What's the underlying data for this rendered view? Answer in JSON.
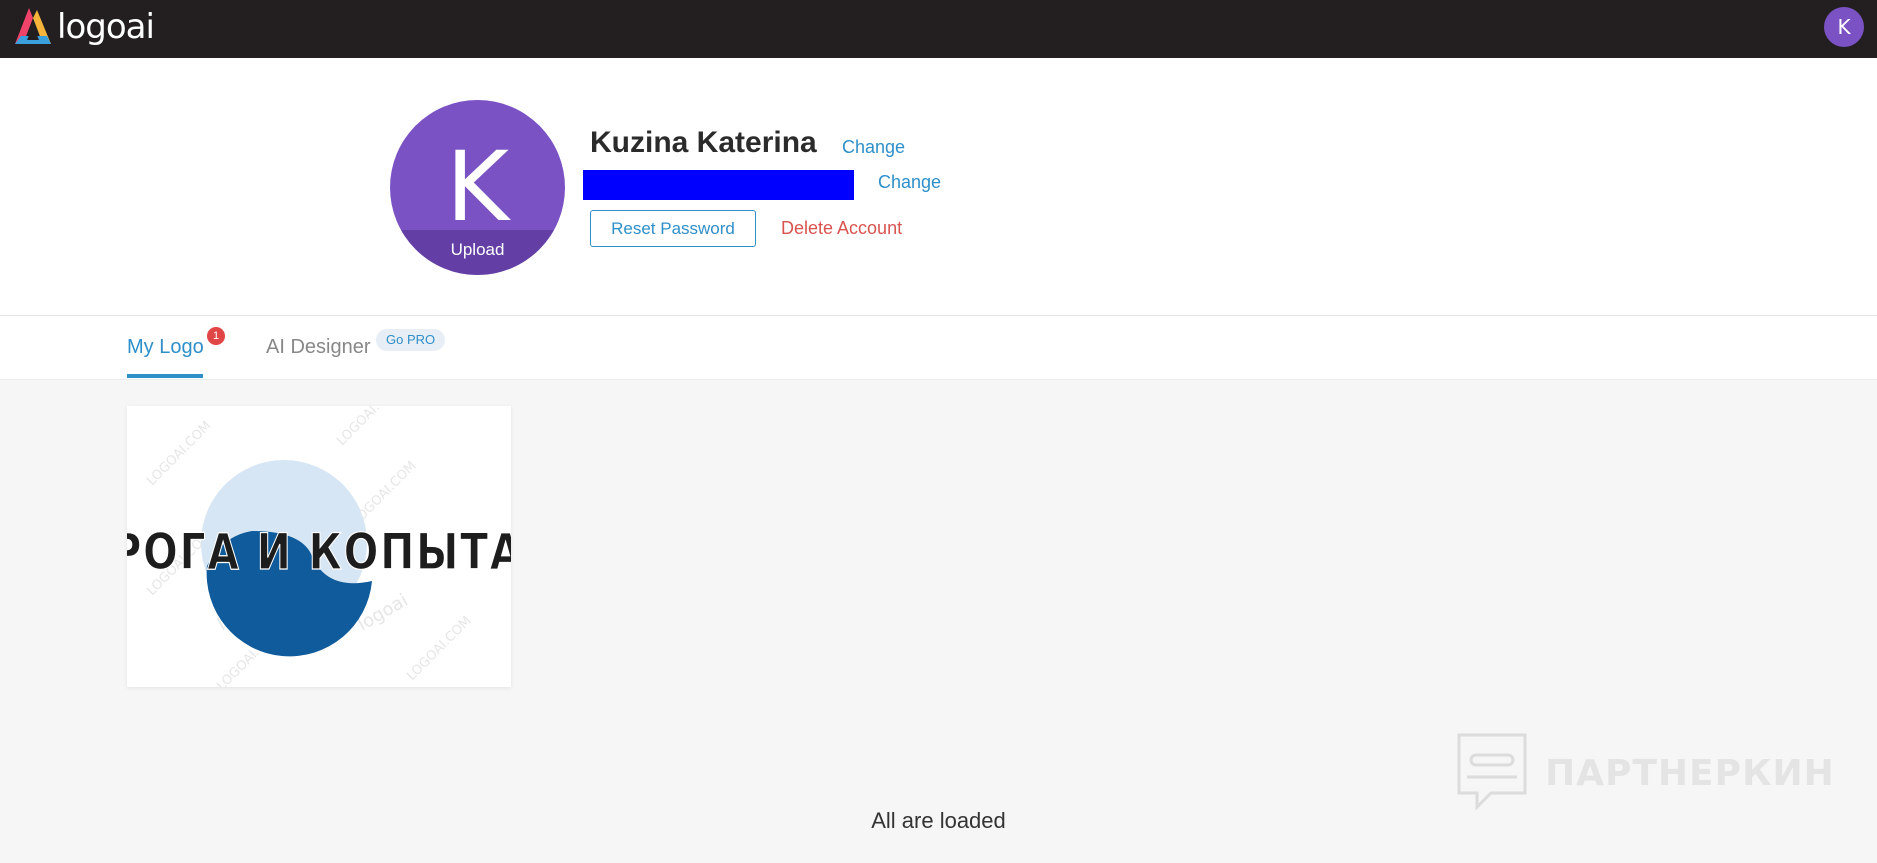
{
  "topbar": {
    "brand_name": "logoai",
    "user_initial": "K"
  },
  "profile": {
    "avatar_initial": "K",
    "upload_label": "Upload",
    "name": "Kuzina Katerina",
    "name_change_label": "Change",
    "email_change_label": "Change",
    "reset_password_label": "Reset Password",
    "delete_account_label": "Delete Account"
  },
  "tabs": {
    "my_logo_label": "My Logo",
    "my_logo_count": "1",
    "ai_designer_label": "AI Designer",
    "go_pro_label": "Go PRO"
  },
  "logos": [
    {
      "text": "РОГА И КОПЫТА",
      "watermark": "LOGOAI.COM",
      "watermark_brand": "logoai"
    }
  ],
  "footer": {
    "status_text": "All are loaded"
  },
  "watermark": {
    "partner_text": "ПАРТНЕРКИН"
  },
  "colors": {
    "topbar": "#231f20",
    "accent_blue": "#2e8fc9",
    "avatar_purple": "#7b52c4",
    "danger_red": "#d9534f",
    "badge_red": "#e04646",
    "redaction_blue": "#0000ff"
  },
  "icons": [
    "logoai-logo-icon",
    "chat-bubble-icon"
  ]
}
